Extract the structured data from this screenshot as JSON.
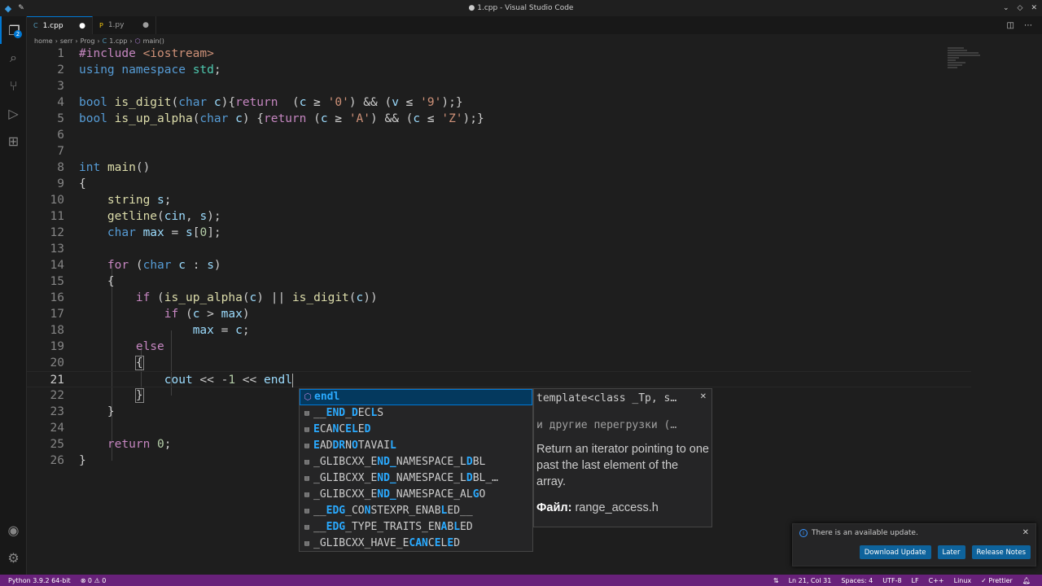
{
  "window": {
    "title": "● 1.cpp - Visual Studio Code"
  },
  "tabs": [
    {
      "label": "1.cpp",
      "dirty": "●"
    },
    {
      "label": "1.py",
      "dirty": "●"
    }
  ],
  "breadcrumb": [
    "home",
    "serr",
    "Prog",
    "1.cpp",
    "main()"
  ],
  "editor": {
    "current_line": 21,
    "line_numbers": [
      "1",
      "2",
      "3",
      "4",
      "5",
      "6",
      "7",
      "8",
      "9",
      "10",
      "11",
      "12",
      "13",
      "14",
      "15",
      "16",
      "17",
      "18",
      "19",
      "20",
      "21",
      "22",
      "23",
      "24",
      "25",
      "26"
    ]
  },
  "suggest": {
    "items": [
      {
        "label": "endl",
        "kind": "function"
      },
      {
        "label": "__END_DECLS",
        "kind": "constant"
      },
      {
        "label": "ECANCELED",
        "kind": "constant"
      },
      {
        "label": "EADDRNOTAVAIL",
        "kind": "constant"
      },
      {
        "label": "_GLIBCXX_END_NAMESPACE_LDBL",
        "kind": "constant"
      },
      {
        "label": "_GLIBCXX_END_NAMESPACE_LDBL_…",
        "kind": "constant"
      },
      {
        "label": "_GLIBCXX_END_NAMESPACE_ALGO",
        "kind": "constant"
      },
      {
        "label": "__EDG_CONSTEXPR_ENABLED__",
        "kind": "constant"
      },
      {
        "label": "__EDG_TYPE_TRAITS_ENABLED",
        "kind": "constant"
      },
      {
        "label": "_GLIBCXX_HAVE_ECANCELED",
        "kind": "constant"
      }
    ],
    "details": {
      "signature": "template<class _Tp, s…",
      "overloads": "и другие перегрузки (…",
      "doc": "Return an iterator pointing to one past the last element of the array.",
      "file_label": "Файл:",
      "file_value": "range_access.h"
    }
  },
  "notification": {
    "message": "There is an available update.",
    "buttons": [
      "Download Update",
      "Later",
      "Release Notes"
    ]
  },
  "statusbar": {
    "python": "Python 3.9.2 64-bit",
    "problems": "⊗ 0 ⚠ 0",
    "position": "Ln 21, Col 31",
    "spaces": "Spaces: 4",
    "encoding": "UTF-8",
    "eol": "LF",
    "language": "C++",
    "platform": "Linux",
    "formatter": "✓ Prettier"
  },
  "colors": {
    "statusbar": "#68217a",
    "accent": "#0078d4",
    "editor_bg": "#1e1e1e"
  }
}
